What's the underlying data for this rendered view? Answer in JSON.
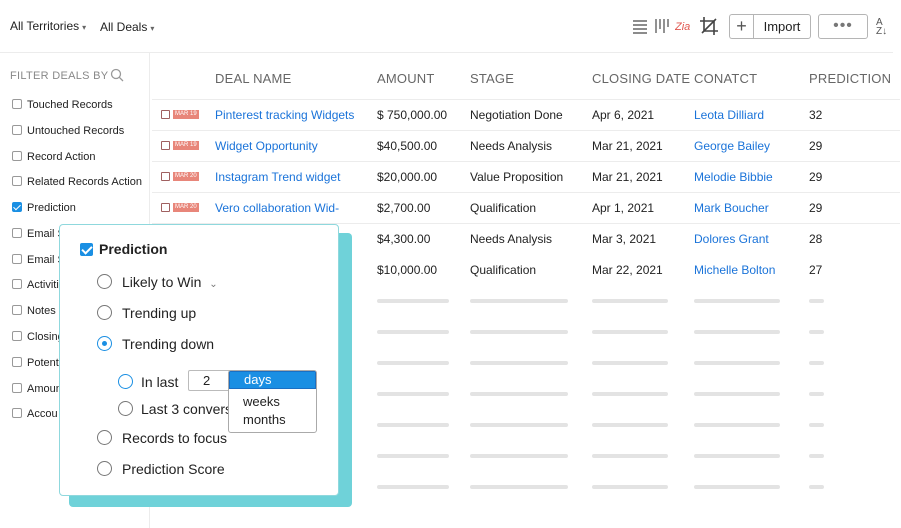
{
  "toolbar": {
    "territory": "All Territories",
    "deals": "All Deals",
    "import_label": "Import",
    "more_label": "•••",
    "sort_label": "A Z"
  },
  "sidebar": {
    "title": "FILTER DEALS BY",
    "items": [
      {
        "label": "Touched Records",
        "checked": false
      },
      {
        "label": "Untouched Records",
        "checked": false
      },
      {
        "label": "Record Action",
        "checked": false
      },
      {
        "label": "Related Records Action",
        "checked": false
      },
      {
        "label": "Prediction",
        "checked": true
      },
      {
        "label": "Email S",
        "checked": false
      },
      {
        "label": "Email S",
        "checked": false
      },
      {
        "label": "Activiti",
        "checked": false
      },
      {
        "label": "Notes",
        "checked": false
      },
      {
        "label": "Closing",
        "checked": false
      },
      {
        "label": "Potent",
        "checked": false
      },
      {
        "label": "Amoun",
        "checked": false
      },
      {
        "label": "Accou",
        "checked": false
      }
    ]
  },
  "table": {
    "headers": [
      "DEAL NAME",
      "AMOUNT",
      "STAGE",
      "CLOSING DATE",
      "CONATCT",
      "PREDICTION"
    ],
    "rows": [
      {
        "tag": "MAR 19",
        "name": "Pinterest tracking Widgets",
        "amount": "$ 750,000.00",
        "stage": "Negotiation Done",
        "closing": "Apr 6, 2021",
        "contact": "Leota Dilliard",
        "prediction": "32"
      },
      {
        "tag": "MAR 19",
        "name": "Widget Opportunity",
        "amount": "$40,500.00",
        "stage": "Needs Analysis",
        "closing": "Mar 21, 2021",
        "contact": "George Bailey",
        "prediction": "29"
      },
      {
        "tag": "MAR 20",
        "name": "Instagram Trend widget",
        "amount": "$20,000.00",
        "stage": "Value Proposition",
        "closing": "Mar 21, 2021",
        "contact": "Melodie Bibbie",
        "prediction": "29"
      },
      {
        "tag": "MAR 20",
        "name": "Vero collaboration Wid-",
        "amount": "$2,700.00",
        "stage": "Qualification",
        "closing": "Apr 1, 2021",
        "contact": "Mark Boucher",
        "prediction": "29"
      },
      {
        "tag": "",
        "name": "",
        "amount": "$4,300.00",
        "stage": "Needs Analysis",
        "closing": "Mar 3, 2021",
        "contact": "Dolores Grant",
        "prediction": "28"
      },
      {
        "tag": "",
        "name": "",
        "amount": "$10,000.00",
        "stage": "Qualification",
        "closing": "Mar 22, 2021",
        "contact": "Michelle Bolton",
        "prediction": "27"
      }
    ]
  },
  "popup": {
    "title": "Prediction",
    "options": [
      "Likely to Win",
      "Trending up",
      "Trending down"
    ],
    "in_last_label": "In last",
    "in_last_value": "2",
    "units": [
      "days",
      "weeks",
      "months"
    ],
    "last3_label": "Last 3 convers",
    "focus_label": "Records to focus",
    "score_label": "Prediction Score"
  },
  "colors": {
    "accent": "#1a8fe3",
    "link": "#1a73d9",
    "popup_shadow": "#6fd2d9",
    "date_tag": "#e8867a"
  }
}
